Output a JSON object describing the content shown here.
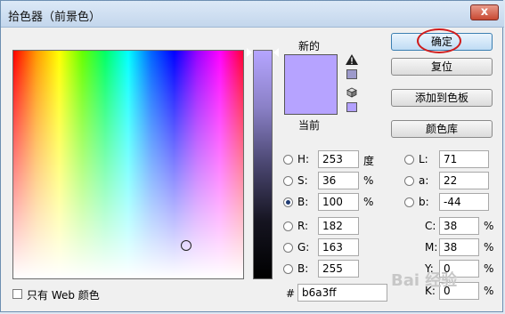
{
  "window": {
    "title": "拾色器（前景色）",
    "close_label": "x"
  },
  "swatch": {
    "new_label": "新的",
    "current_label": "当前",
    "new_color": "#b6a3ff"
  },
  "buttons": {
    "ok": "确定",
    "reset": "复位",
    "add_swatch": "添加到色板",
    "libraries": "颜色库"
  },
  "hsb": [
    {
      "label": "H:",
      "value": "253",
      "unit": "度",
      "selected": false
    },
    {
      "label": "S:",
      "value": "36",
      "unit": "%",
      "selected": false
    },
    {
      "label": "B:",
      "value": "100",
      "unit": "%",
      "selected": true
    }
  ],
  "rgb": [
    {
      "label": "R:",
      "value": "182"
    },
    {
      "label": "G:",
      "value": "163"
    },
    {
      "label": "B:",
      "value": "255"
    }
  ],
  "lab": [
    {
      "label": "L:",
      "value": "71"
    },
    {
      "label": "a:",
      "value": "22"
    },
    {
      "label": "b:",
      "value": "-44"
    }
  ],
  "cmyk": [
    {
      "label": "C:",
      "value": "38",
      "unit": "%"
    },
    {
      "label": "M:",
      "value": "38",
      "unit": "%"
    },
    {
      "label": "Y:",
      "value": "0",
      "unit": "%"
    },
    {
      "label": "K:",
      "value": "0",
      "unit": "%"
    }
  ],
  "hex": {
    "label": "#",
    "value": "b6a3ff"
  },
  "web_only": {
    "label": "只有 Web 颜色",
    "checked": false
  },
  "watermark": "Bai 经验",
  "icons": [
    "warning-icon",
    "cube-icon",
    "close-icon"
  ]
}
